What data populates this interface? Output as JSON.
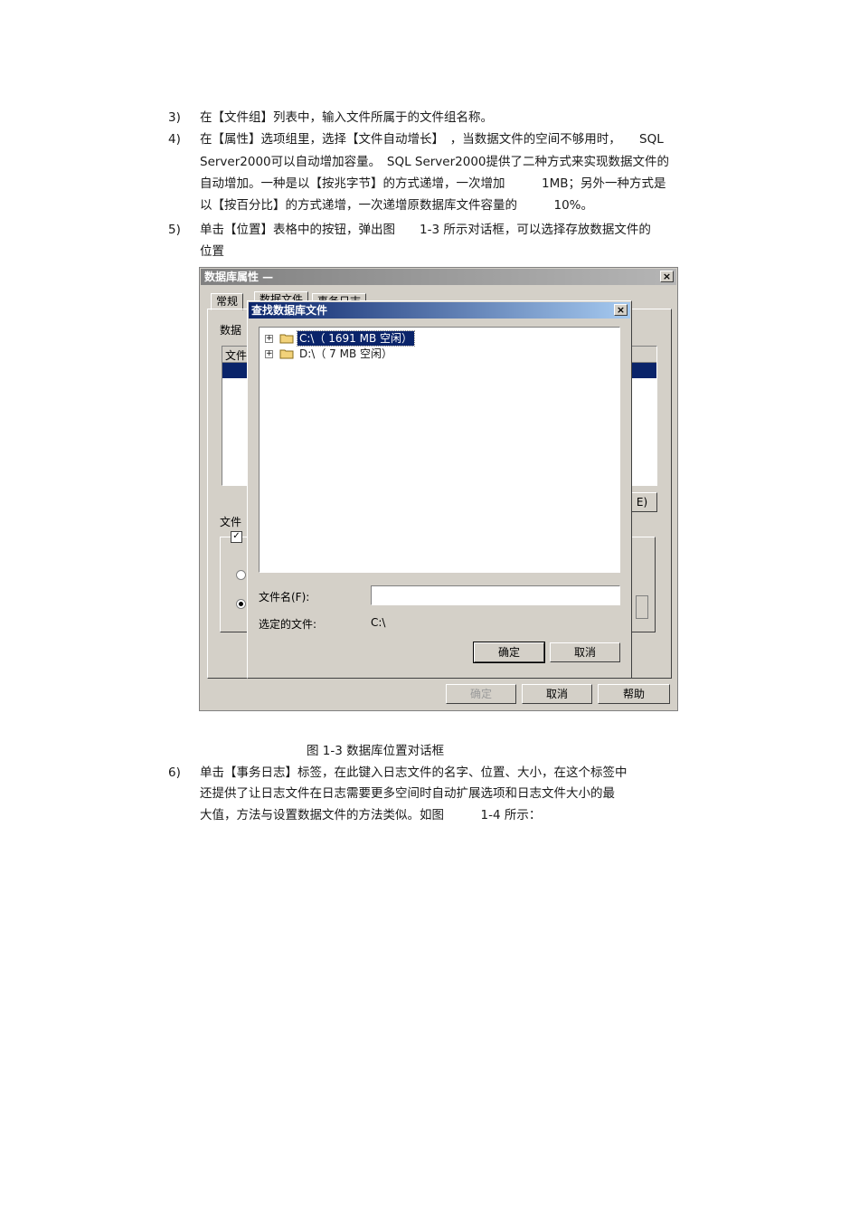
{
  "paragraphs_top": [
    {
      "num": "3)",
      "lines": [
        "在【文件组】列表中，输入文件所属于的文件组名称。"
      ]
    },
    {
      "num": "4)",
      "lines": [
        "在【属性】选项组里，选择【文件自动增长】　，当数据文件的空间不够用时，　　SQL",
        "Server2000可以自动增加容量。　SQL Server2000提供了二种方式来实现数据文件的",
        "自动增加。一种是以【按兆字节】的方式递增，一次增加　　　1MB；另外一种方式是",
        "以【按百分比】的方式递增，一次递增原数据库文件容量的　　　10%。"
      ]
    },
    {
      "num": "5)",
      "lines": [
        "单击【位置】表格中的按钮，弹出图　　1-3 所示对话框，可以选择存放数据文件的",
        "位置"
      ]
    }
  ],
  "figure": {
    "outer_window": {
      "title": "数据库属性 —",
      "tabs": [
        "常规",
        "数据文件",
        "事务日志"
      ],
      "section_label": "数据",
      "file_column": "文件",
      "file_props_label": "文件",
      "buttons": {
        "ok": "确定",
        "cancel": "取消",
        "help": "帮助"
      },
      "partial_button": "E)"
    },
    "dialog": {
      "title": "查找数据库文件",
      "tree": [
        {
          "label": "C:\\（ 1691 MB 空闲）",
          "selected": true
        },
        {
          "label": "D:\\（ 7 MB 空闲）",
          "selected": false
        }
      ],
      "filename_label": "文件名(F):",
      "filename_value": "",
      "selected_label": "选定的文件:",
      "selected_value": "C:\\",
      "ok": "确定",
      "cancel": "取消"
    }
  },
  "caption": "图 1-3  数据库位置对话框",
  "paragraphs_bottom": [
    {
      "num": "6)",
      "lines": [
        "单击【事务日志】标签，在此键入日志文件的名字、位置、大小，在这个标签中",
        "还提供了让日志文件在日志需要更多空间时自动扩展选项和日志文件大小的最",
        "大值，方法与设置数据文件的方法类似。如图　　　1-4 所示："
      ]
    }
  ],
  "colors": {
    "dialog_title_start": "#0a246a",
    "dialog_title_end": "#a6caf0",
    "selection": "#0a246a",
    "face": "#d4d0c8"
  }
}
